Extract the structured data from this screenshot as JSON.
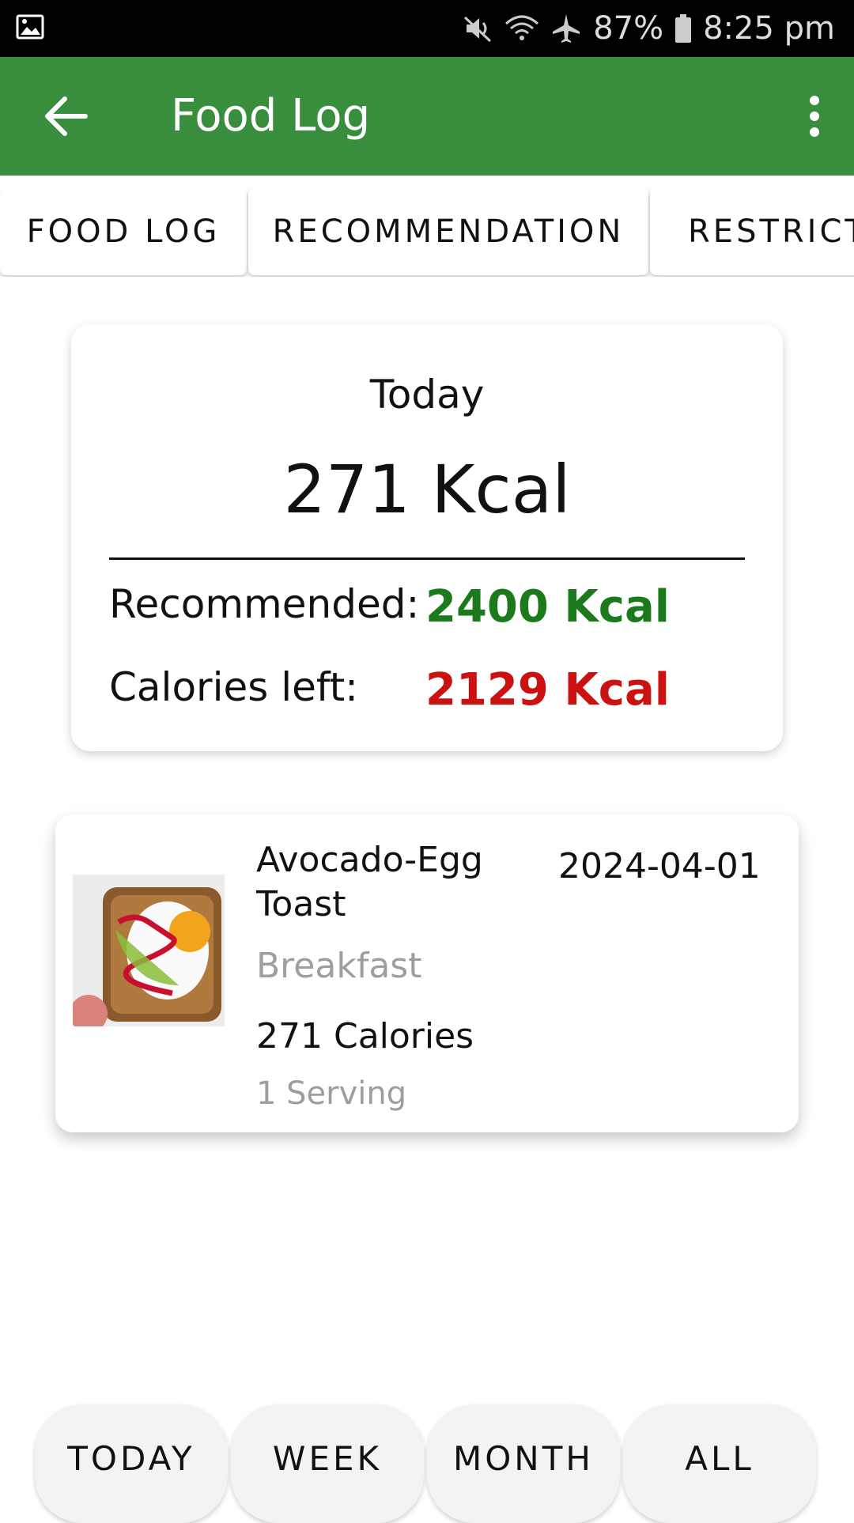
{
  "status_bar": {
    "battery": "87%",
    "time": "8:25 pm",
    "icons": [
      "image-icon",
      "mute-icon",
      "wifi-icon",
      "airplane-icon",
      "battery-icon"
    ]
  },
  "app_bar": {
    "title": "Food Log",
    "background": "#388e3c"
  },
  "tabs": [
    {
      "label": "FOOD LOG"
    },
    {
      "label": "RECOMMENDATION"
    },
    {
      "label": "RESTRICT"
    }
  ],
  "summary": {
    "period": "Today",
    "consumed": "271 Kcal",
    "recommended_label": "Recommended:",
    "recommended_value": "2400 Kcal",
    "recommended_color": "#1b7a1b",
    "left_label": "Calories left:",
    "left_value": "2129 Kcal",
    "left_color": "#cc1111"
  },
  "entries": [
    {
      "name": "Avocado-Egg Toast",
      "date": "2024-04-01",
      "meal": "Breakfast",
      "calories": "271 Calories",
      "serving": "1 Serving"
    }
  ],
  "filters": [
    {
      "label": "TODAY"
    },
    {
      "label": "WEEK"
    },
    {
      "label": "MONTH"
    },
    {
      "label": "ALL"
    }
  ]
}
